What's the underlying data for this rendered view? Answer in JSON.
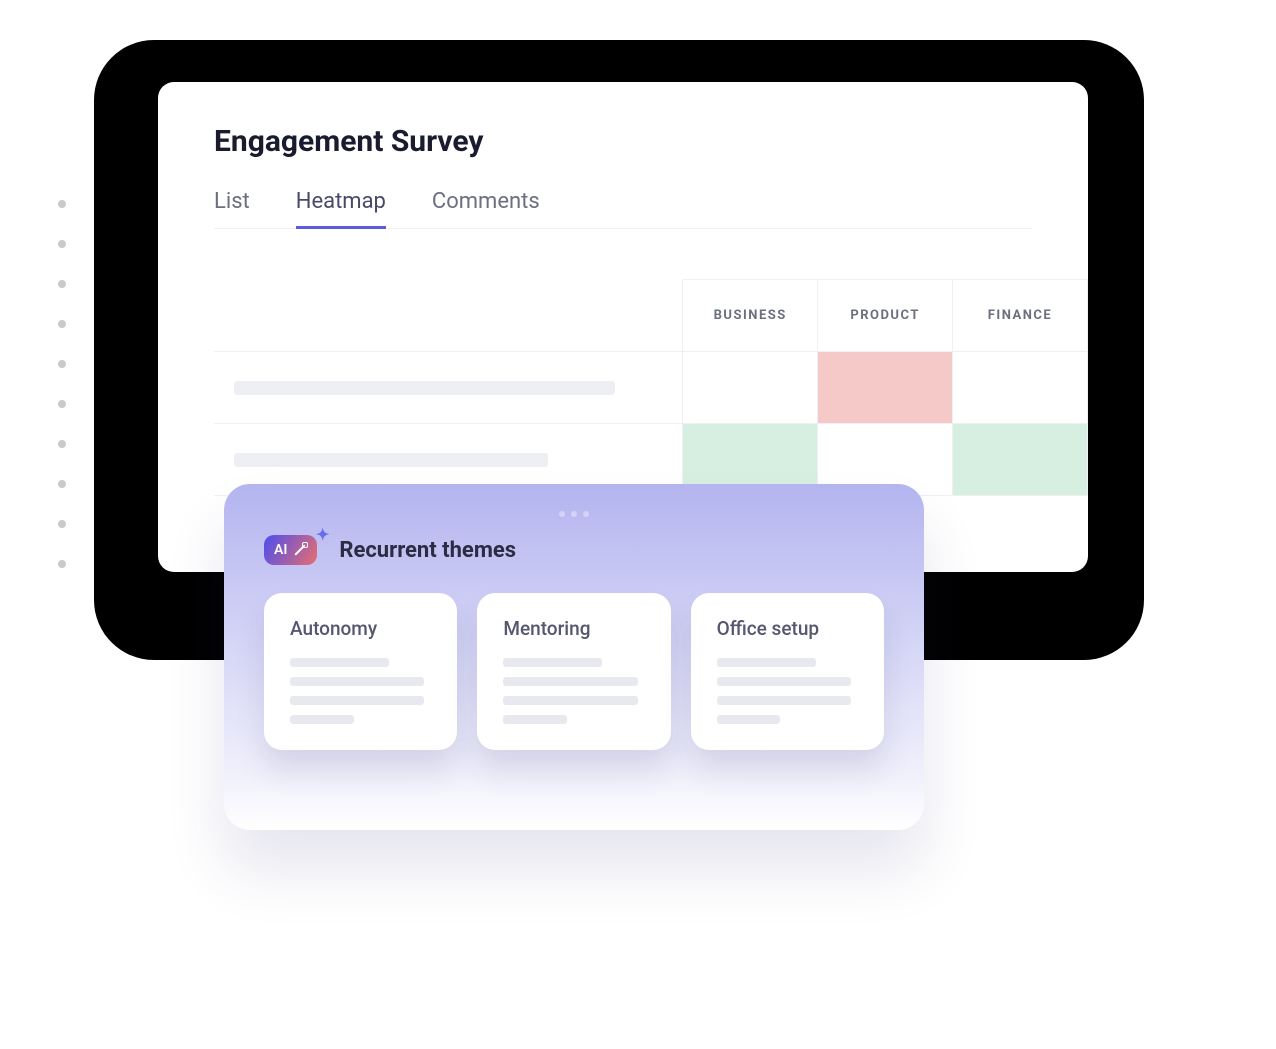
{
  "window": {
    "title": "Engagement Survey",
    "tabs": [
      {
        "label": "List",
        "active": false
      },
      {
        "label": "Heatmap",
        "active": true
      },
      {
        "label": "Comments",
        "active": false
      }
    ]
  },
  "heatmap": {
    "columns": [
      "BUSINESS",
      "PRODUCT",
      "FINANCE"
    ],
    "rows": [
      {
        "cells": [
          "",
          "red",
          ""
        ]
      },
      {
        "cells": [
          "green",
          "",
          "green"
        ]
      }
    ],
    "colors": {
      "red": "#f6c9c9",
      "green": "#d6efe0"
    }
  },
  "themes": {
    "badge_text": "AI",
    "title": "Recurrent themes",
    "cards": [
      {
        "title": "Autonomy"
      },
      {
        "title": "Mentoring"
      },
      {
        "title": "Office setup"
      }
    ]
  }
}
